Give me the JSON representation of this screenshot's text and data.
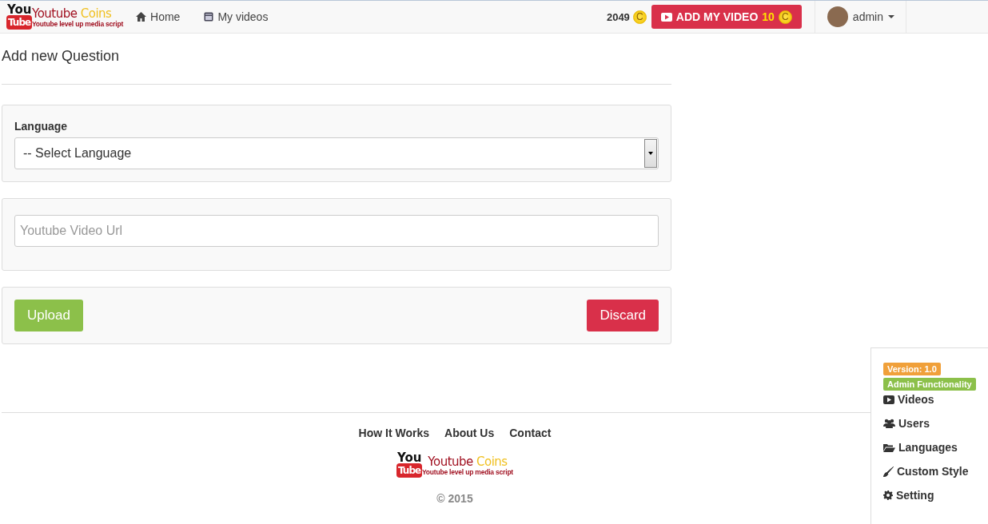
{
  "header": {
    "logo": {
      "icon_top": "You",
      "icon_bottom": "Tube",
      "name": "Youtube",
      "name_accent": "Coins",
      "tagline": "Youtube level up media script"
    },
    "nav": [
      {
        "label": "Home"
      },
      {
        "label": "My videos"
      }
    ],
    "balance": "2049",
    "balance_coin": "C",
    "add_button": {
      "label": "ADD MY VIDEO",
      "cost": "10",
      "coin": "C"
    },
    "user": {
      "name": "admin"
    }
  },
  "page_title": "Add new Question",
  "form": {
    "language": {
      "label": "Language",
      "value": "-- Select Language"
    },
    "url": {
      "placeholder": "Youtube Video Url"
    },
    "buttons": [
      {
        "label": "Upload",
        "kind": "primary"
      },
      {
        "label": "Discard",
        "kind": "danger"
      }
    ]
  },
  "footer": {
    "links": [
      "How It Works",
      "About Us",
      "Contact"
    ],
    "logo": {
      "icon_top": "You",
      "icon_bottom": "Tube",
      "name": "Youtube",
      "name_accent": "Coins",
      "tagline": "Youtube level up media script"
    },
    "copyright": "© 2015"
  },
  "admin_panel": {
    "badges": [
      {
        "label": "Version: 1.0",
        "color": "#f0a03a"
      },
      {
        "label": "Admin Functionality",
        "color": "#8cc04a"
      }
    ],
    "items": [
      {
        "label": "Videos"
      },
      {
        "label": "Users"
      },
      {
        "label": "Languages"
      },
      {
        "label": "Custom Style"
      },
      {
        "label": "Setting"
      }
    ]
  }
}
